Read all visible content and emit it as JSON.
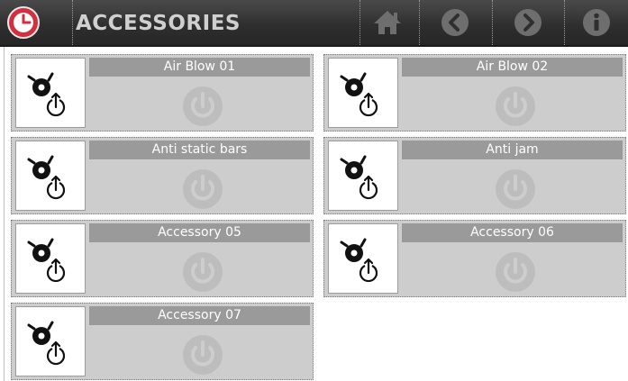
{
  "header": {
    "title": "ACCESSORIES",
    "clock_icon": "clock-icon",
    "nav": [
      {
        "name": "home",
        "icon": "home-icon"
      },
      {
        "name": "back",
        "icon": "arrow-left-icon"
      },
      {
        "name": "forward",
        "icon": "arrow-right-icon"
      },
      {
        "name": "info",
        "icon": "info-icon"
      }
    ]
  },
  "colors": {
    "header_bg": "#2f2f2f",
    "clock_red": "#d32f3f",
    "card_bg": "#cdcdcd",
    "label_bg": "#9a9a9a",
    "power_icon": "#bdbdbd"
  },
  "accessories": [
    {
      "label": "Air Blow 01",
      "state": "off"
    },
    {
      "label": "Air Blow 02",
      "state": "off"
    },
    {
      "label": "Anti static bars",
      "state": "off"
    },
    {
      "label": "Anti jam",
      "state": "off"
    },
    {
      "label": "Accessory 05",
      "state": "off"
    },
    {
      "label": "Accessory 06",
      "state": "off"
    },
    {
      "label": "Accessory 07",
      "state": "off"
    }
  ]
}
